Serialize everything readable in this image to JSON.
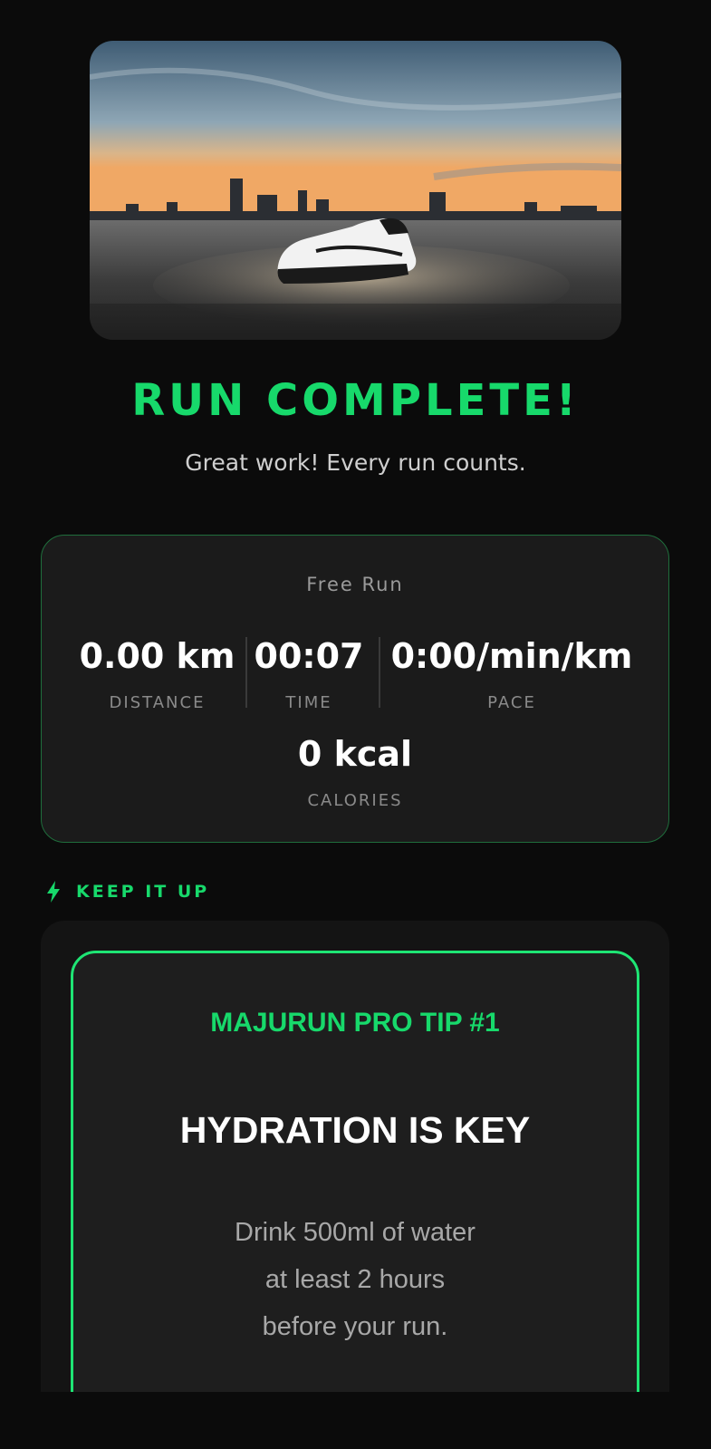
{
  "hero": {
    "image": "running-shoe-on-wet-road-city-sunset"
  },
  "header": {
    "title": "RUN COMPLETE!",
    "subtitle": "Great work! Every run counts."
  },
  "summary": {
    "run_type": "Free Run",
    "distance": {
      "value": "0.00 km",
      "label": "DISTANCE"
    },
    "time": {
      "value": "00:07",
      "label": "TIME"
    },
    "pace": {
      "value": "0:00/min/km",
      "label": "PACE"
    },
    "calories": {
      "value": "0 kcal",
      "label": "CALORIES"
    }
  },
  "motivation": {
    "icon": "lightning-bolt-icon",
    "heading": "KEEP IT UP",
    "tip": {
      "label": "MAJURUN PRO TIP #1",
      "title": "HYDRATION IS KEY",
      "lines": [
        "Drink 500ml of water",
        "at least 2 hours",
        "before your run."
      ]
    }
  },
  "colors": {
    "accent": "#17d96b",
    "background": "#0b0b0b",
    "card": "#1b1b1b"
  }
}
